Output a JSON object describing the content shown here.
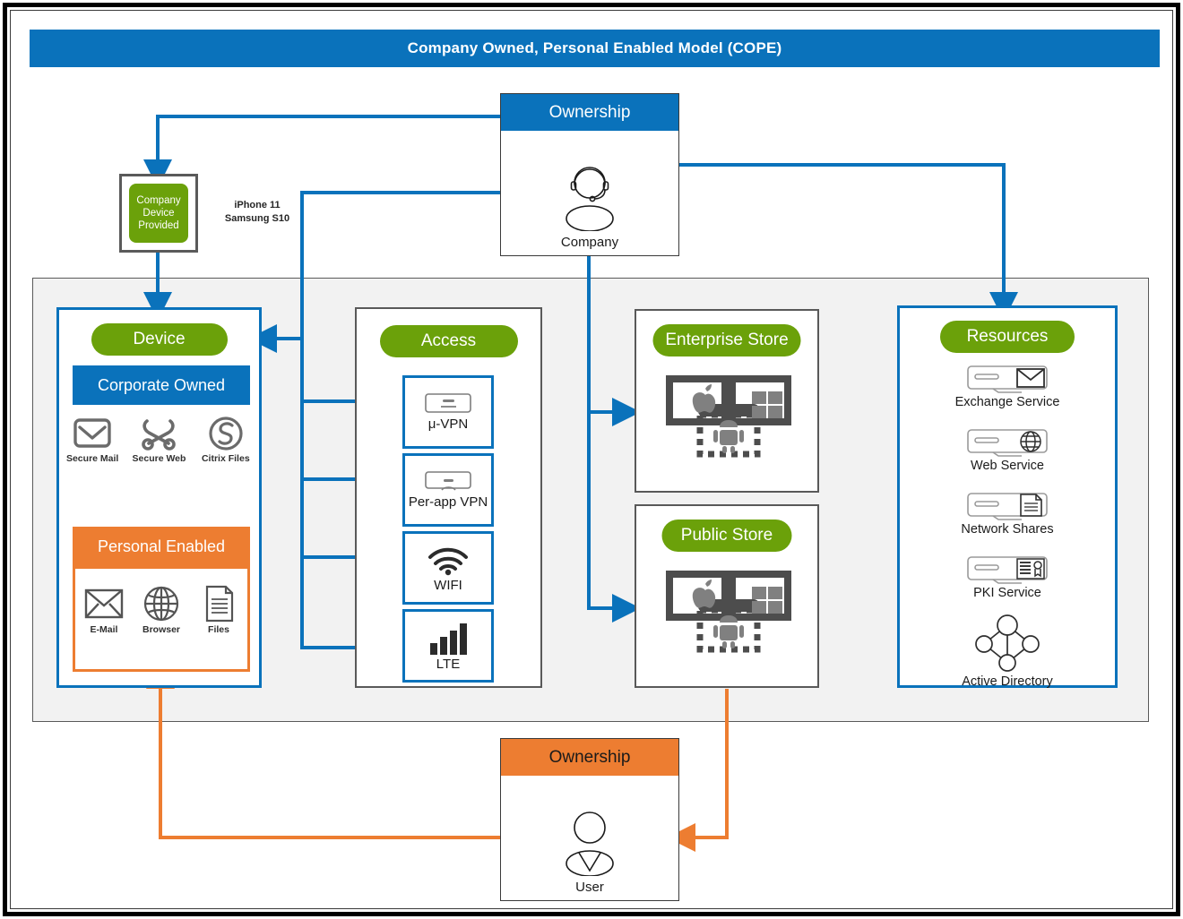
{
  "title": "Company Owned, Personal Enabled Model (COPE)",
  "colors": {
    "blue": "#0a72bb",
    "green": "#6ba10a",
    "orange": "#ed7d31",
    "gray_zone": "#f2f2f2",
    "gray_border": "#595959",
    "icon_gray": "#6b6b6b"
  },
  "device_provided": {
    "label_lines": [
      "Company",
      "Device",
      "Provided"
    ],
    "models": [
      "iPhone 11",
      "Samsung S10"
    ]
  },
  "ownership_company": {
    "header": "Ownership",
    "actor": "Company",
    "icon": "headset-person-icon"
  },
  "ownership_user": {
    "header": "Ownership",
    "actor": "User",
    "icon": "person-icon"
  },
  "device": {
    "title": "Device",
    "corporate": {
      "header": "Corporate Owned",
      "apps": [
        {
          "label": "Secure Mail",
          "icon": "secure-mail-icon"
        },
        {
          "label": "Secure Web",
          "icon": "secure-web-icon"
        },
        {
          "label": "Citrix Files",
          "icon": "citrix-files-icon"
        }
      ]
    },
    "personal": {
      "header": "Personal Enabled",
      "apps": [
        {
          "label": "E-Mail",
          "icon": "envelope-icon"
        },
        {
          "label": "Browser",
          "icon": "globe-icon"
        },
        {
          "label": "Files",
          "icon": "document-icon"
        }
      ]
    }
  },
  "access": {
    "title": "Access",
    "tiles": [
      {
        "label": "μ-VPN",
        "icon": "vpn-tunnel-icon"
      },
      {
        "label": "Per-app VPN",
        "icon": "per-app-vpn-icon"
      },
      {
        "label": "WIFI",
        "icon": "wifi-icon"
      },
      {
        "label": "LTE",
        "icon": "signal-bars-icon"
      }
    ]
  },
  "enterprise_store": {
    "title": "Enterprise Store",
    "icon": "app-store-platforms-icon",
    "platforms": [
      "apple",
      "windows",
      "android"
    ]
  },
  "public_store": {
    "title": "Public Store",
    "icon": "app-store-platforms-icon",
    "platforms": [
      "apple",
      "windows",
      "android"
    ]
  },
  "resources": {
    "title": "Resources",
    "items": [
      {
        "label": "Exchange Service",
        "icon": "server-mail-icon"
      },
      {
        "label": "Web Service",
        "icon": "server-globe-icon"
      },
      {
        "label": "Network Shares",
        "icon": "server-document-icon"
      },
      {
        "label": "PKI Service",
        "icon": "server-certificate-icon"
      },
      {
        "label": "Active Directory",
        "icon": "active-directory-nodes-icon"
      }
    ]
  }
}
